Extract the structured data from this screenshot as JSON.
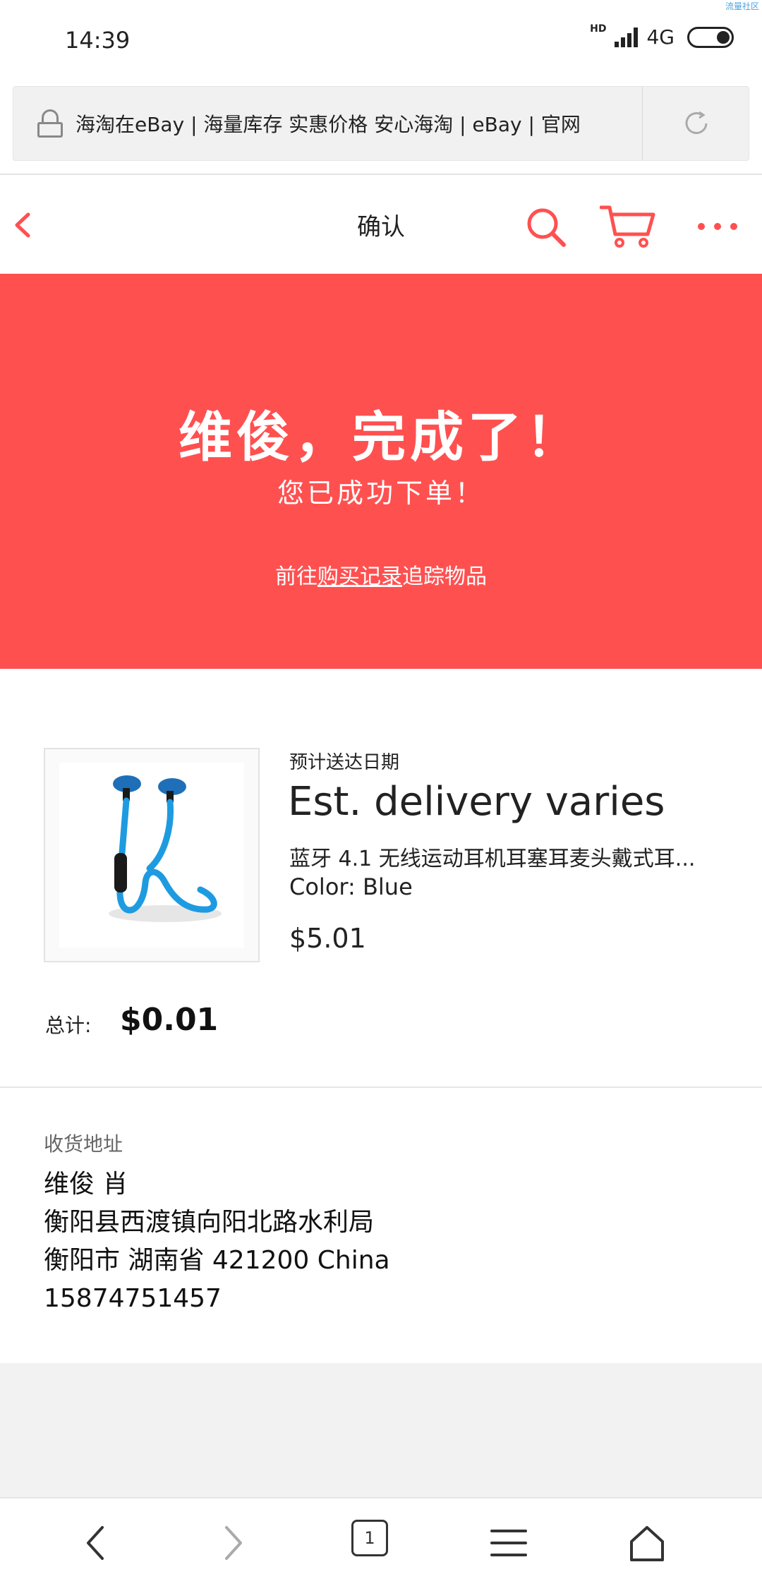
{
  "status_bar": {
    "time": "14:39",
    "hd": "HD",
    "network": "4G",
    "watermark": "流量社区"
  },
  "url_bar": {
    "url_text": "海淘在eBay | 海量库存 实惠价格 安心海淘 | eBay | 官网"
  },
  "header": {
    "title": "确认"
  },
  "banner": {
    "title": "维俊，完成了！",
    "subtitle": "您已成功下单！",
    "link_prefix": "前往",
    "link_text": "购买记录",
    "link_suffix": "追踪物品",
    "background": "#ff5050"
  },
  "item": {
    "delivery_label": "预计送达日期",
    "delivery_value": "Est. delivery varies",
    "title": "蓝牙 4.1 无线运动耳机耳塞耳麦头戴式耳...",
    "color": "Color: Blue",
    "price": "$5.01"
  },
  "total": {
    "label": "总计:",
    "value": "$0.01"
  },
  "address": {
    "label": "收货地址",
    "lines": [
      "维俊 肖",
      "衡阳县西渡镇向阳北路水利局",
      "衡阳市 湖南省 421200 China",
      "15874751457"
    ]
  },
  "bottom_nav": {
    "tab_count": "1"
  },
  "colors": {
    "accent": "#ff5050",
    "product_blue": "#1e9be0"
  }
}
